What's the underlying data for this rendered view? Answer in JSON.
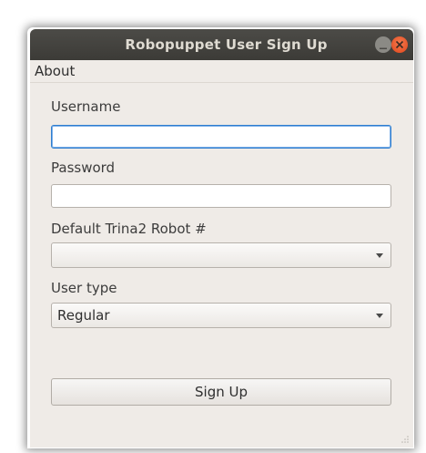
{
  "window": {
    "title": "Robopuppet User Sign Up"
  },
  "menubar": {
    "items": [
      {
        "label": "About"
      }
    ]
  },
  "form": {
    "username": {
      "label": "Username",
      "value": ""
    },
    "password": {
      "label": "Password",
      "value": ""
    },
    "robot": {
      "label": "Default Trina2 Robot #",
      "selected": ""
    },
    "user_type": {
      "label": "User type",
      "selected": "Regular"
    },
    "submit_label": "Sign Up"
  },
  "icons": {
    "minimize": "minimize-icon",
    "close": "close-icon",
    "dropdown": "chevron-down-icon"
  },
  "colors": {
    "titlebar": "#3c3b37",
    "close_button": "#e1461b",
    "window_bg": "#efebe7",
    "focus_border": "#2f7ecf"
  }
}
